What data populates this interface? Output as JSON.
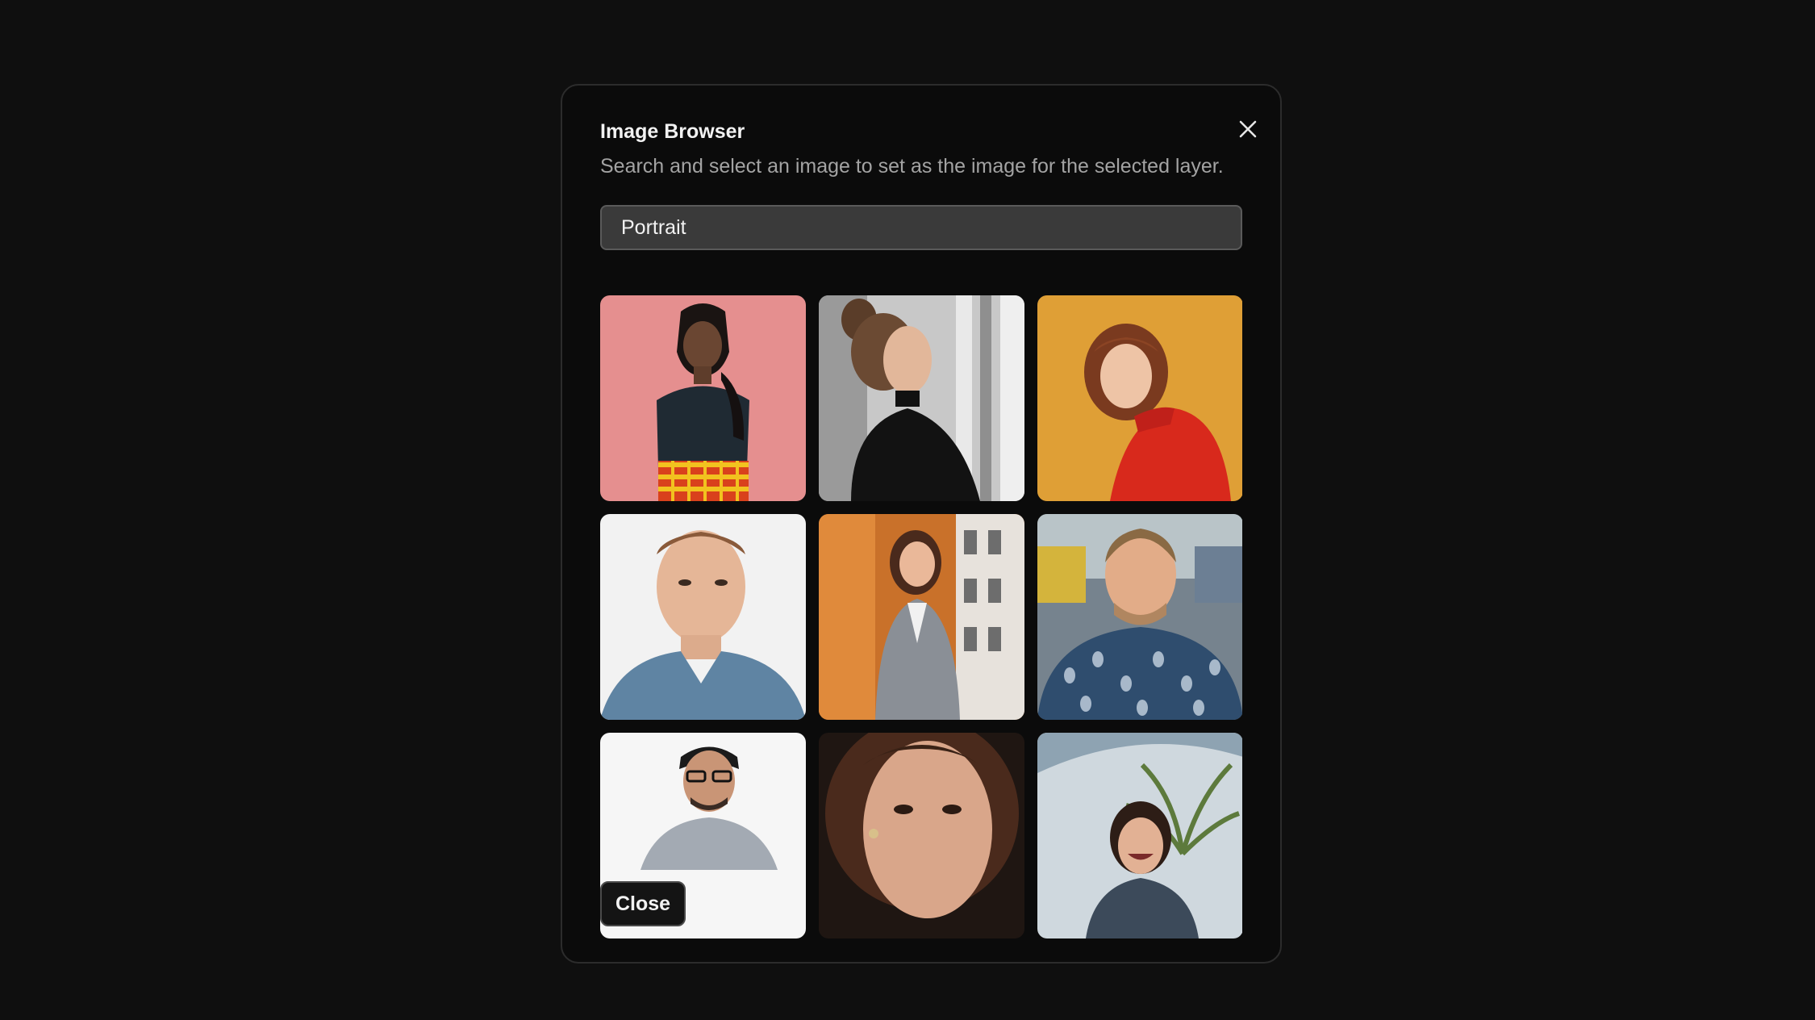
{
  "dialog": {
    "title": "Image Browser",
    "subtitle": "Search and select an image to set as the image for the selected layer.",
    "close_icon": "close-icon"
  },
  "search": {
    "value": "Portrait"
  },
  "images": [
    {
      "name": "portrait-woman-pink-background",
      "bg": "#e58a8a"
    },
    {
      "name": "portrait-woman-black-turtleneck",
      "bg": "#b9b9b9"
    },
    {
      "name": "portrait-woman-red-sweater-yellow",
      "bg": "#e2a43a"
    },
    {
      "name": "portrait-man-blue-vneck",
      "bg": "#efefef"
    },
    {
      "name": "portrait-woman-grey-blazer-orange",
      "bg": "#d4782c"
    },
    {
      "name": "portrait-man-patterned-shirt",
      "bg": "#6f7f8c"
    },
    {
      "name": "portrait-man-glasses-white",
      "bg": "#f4f4f4"
    },
    {
      "name": "portrait-woman-closeup-dark",
      "bg": "#2a1e1a"
    },
    {
      "name": "portrait-woman-smiling-plants",
      "bg": "#c9d2d8"
    }
  ],
  "footer": {
    "close_label": "Close"
  }
}
